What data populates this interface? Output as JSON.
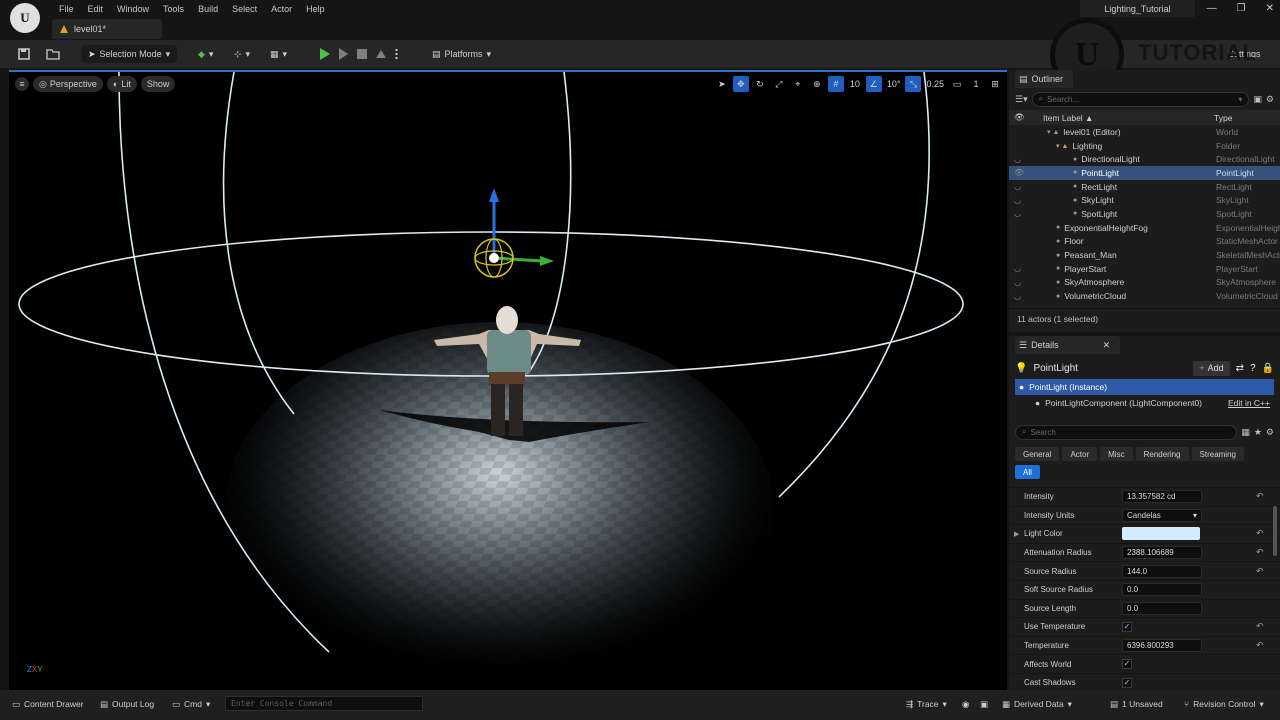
{
  "menu": [
    "File",
    "Edit",
    "Window",
    "Tools",
    "Build",
    "Select",
    "Actor",
    "Help"
  ],
  "level_tab": "level01*",
  "project_name": "Lighting_Tutorial",
  "window_controls": [
    "—",
    "❐",
    "✕"
  ],
  "toolbar": {
    "selection_mode": "Selection Mode",
    "platforms": "Platforms",
    "settings": "Settings"
  },
  "watermark": {
    "logo_glyph": "U",
    "text": "TUTORIAL"
  },
  "viewport": {
    "perspective": "Perspective",
    "lit": "Lit",
    "show": "Show",
    "grid_snap": "10",
    "rot_snap": "10°",
    "scale_snap": "0.25",
    "camera_speed": "1",
    "axis_labels": [
      "Z",
      "X",
      "Y"
    ]
  },
  "outliner": {
    "tab": "Outliner",
    "search_placeholder": "Search...",
    "col_label": "Item Label ▲",
    "col_type": "Type",
    "rows": [
      {
        "label": "level01 (Editor)",
        "type": "World",
        "indent": 0,
        "eye": "",
        "selected": false
      },
      {
        "label": "Lighting",
        "type": "Folder",
        "indent": 1,
        "eye": "",
        "selected": false
      },
      {
        "label": "DirectionalLight",
        "type": "DirectionalLight",
        "indent": 2,
        "eye": "◡",
        "selected": false
      },
      {
        "label": "PointLight",
        "type": "PointLight",
        "indent": 2,
        "eye": "👁",
        "selected": true
      },
      {
        "label": "RectLight",
        "type": "RectLight",
        "indent": 2,
        "eye": "◡",
        "selected": false
      },
      {
        "label": "SkyLight",
        "type": "SkyLight",
        "indent": 2,
        "eye": "◡",
        "selected": false
      },
      {
        "label": "SpotLight",
        "type": "SpotLight",
        "indent": 2,
        "eye": "◡",
        "selected": false
      },
      {
        "label": "ExponentialHeightFog",
        "type": "ExponentialHeightFog",
        "indent": 1,
        "eye": "",
        "selected": false
      },
      {
        "label": "Floor",
        "type": "StaticMeshActor",
        "indent": 1,
        "eye": "",
        "selected": false
      },
      {
        "label": "Peasant_Man",
        "type": "SkeletalMeshActor",
        "indent": 1,
        "eye": "",
        "selected": false
      },
      {
        "label": "PlayerStart",
        "type": "PlayerStart",
        "indent": 1,
        "eye": "◡",
        "selected": false
      },
      {
        "label": "SkyAtmosphere",
        "type": "SkyAtmosphere",
        "indent": 1,
        "eye": "◡",
        "selected": false
      },
      {
        "label": "VolumetricCloud",
        "type": "VolumetricCloud",
        "indent": 1,
        "eye": "◡",
        "selected": false
      }
    ],
    "actor_count": "11 actors (1 selected)"
  },
  "details": {
    "tab": "Details",
    "object_name": "PointLight",
    "add_label": "Add",
    "instance": "PointLight (Instance)",
    "component": "PointLightComponent (LightComponent0)",
    "edit_cpp": "Edit in C++",
    "search_placeholder": "Search",
    "filters": [
      "General",
      "Actor",
      "Misc",
      "Rendering",
      "Streaming",
      "All"
    ],
    "light_color_hex": "#d4ecff",
    "properties": [
      {
        "label": "Intensity",
        "kind": "text",
        "value": "13.357582 cd",
        "reset": true
      },
      {
        "label": "Intensity Units",
        "kind": "select",
        "value": "Candelas",
        "reset": false
      },
      {
        "label": "Light Color",
        "kind": "color",
        "value": "",
        "reset": true
      },
      {
        "label": "Attenuation Radius",
        "kind": "text",
        "value": "2388.106689",
        "reset": true
      },
      {
        "label": "Source Radius",
        "kind": "text",
        "value": "144.0",
        "reset": true
      },
      {
        "label": "Soft Source Radius",
        "kind": "text",
        "value": "0.0",
        "reset": false
      },
      {
        "label": "Source Length",
        "kind": "text",
        "value": "0.0",
        "reset": false
      },
      {
        "label": "Use Temperature",
        "kind": "check",
        "value": "✓",
        "reset": true
      },
      {
        "label": "Temperature",
        "kind": "text",
        "value": "6396.800293",
        "reset": true
      },
      {
        "label": "Affects World",
        "kind": "check",
        "value": "✓",
        "reset": false
      },
      {
        "label": "Cast Shadows",
        "kind": "check",
        "value": "✓",
        "reset": false
      }
    ]
  },
  "statusbar": {
    "content_drawer": "Content Drawer",
    "output_log": "Output Log",
    "cmd": "Cmd",
    "console_placeholder": "Enter Console Command",
    "trace": "Trace",
    "derived_data": "Derived Data",
    "unsaved": "1 Unsaved",
    "revision_control": "Revision Control"
  },
  "accent": "#2f74c9"
}
